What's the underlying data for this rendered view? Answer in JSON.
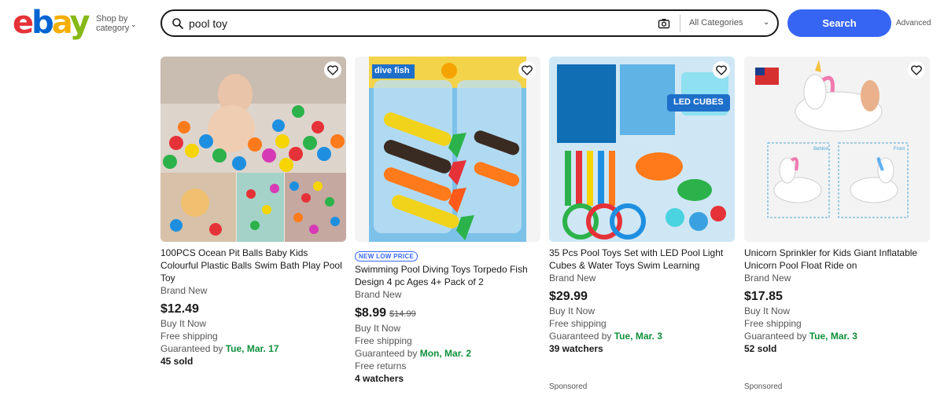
{
  "header": {
    "logo_letters": [
      "e",
      "b",
      "a",
      "y"
    ],
    "shop_by_line1": "Shop by",
    "shop_by_line2": "category",
    "search_value": "pool toy",
    "category_select": "All Categories",
    "search_button": "Search",
    "advanced_link": "Advanced",
    "colors": {
      "search_button": "#3665f3",
      "logo_e": "#e53238",
      "logo_b": "#0064d2",
      "logo_a": "#f5af02",
      "logo_y": "#86b817"
    }
  },
  "cards": [
    {
      "title": "100PCS Ocean Pit Balls Baby Kids Colourful Plastic Balls Swim Bath Play Pool Toy",
      "condition": "Brand New",
      "price": "$12.49",
      "format": "Buy It Now",
      "shipping": "Free shipping",
      "guaranteed_prefix": "Guaranteed by",
      "guaranteed_date": "Tue, Mar. 17",
      "extra": "45 sold"
    },
    {
      "badge": "NEW LOW PRICE",
      "title": "Swimming Pool Diving Toys Torpedo Fish Design 4 pc Ages 4+ Pack of 2",
      "condition": "Brand New",
      "price": "$8.99",
      "was_price": "$14.99",
      "format": "Buy It Now",
      "shipping": "Free shipping",
      "guaranteed_prefix": "Guaranteed by",
      "guaranteed_date": "Mon, Mar. 2",
      "returns": "Free returns",
      "extra": "4 watchers",
      "image_text": "dive fish"
    },
    {
      "title": "35 Pcs Pool Toys Set with LED Pool Light Cubes & Water Toys Swim Learning",
      "condition": "Brand New",
      "price": "$29.99",
      "format": "Buy It Now",
      "shipping": "Free shipping",
      "guaranteed_prefix": "Guaranteed by",
      "guaranteed_date": "Tue, Mar. 3",
      "extra": "39 watchers",
      "sponsored": "Sponsored",
      "image_text": "LED CUBES"
    },
    {
      "title": "Unicorn Sprinkler for Kids Giant Inflatable Unicorn Pool Float Ride on",
      "condition": "Brand New",
      "price": "$17.85",
      "format": "Buy It Now",
      "shipping": "Free shipping",
      "guaranteed_prefix": "Guaranteed by",
      "guaranteed_date": "Tue, Mar. 3",
      "extra": "52 sold",
      "sponsored": "Sponsored",
      "image_labels": [
        "Behind",
        "Front"
      ]
    }
  ],
  "icons": {
    "search": "search-icon",
    "camera": "camera-icon",
    "chevron": "chevron-down-icon",
    "heart": "heart-icon"
  }
}
